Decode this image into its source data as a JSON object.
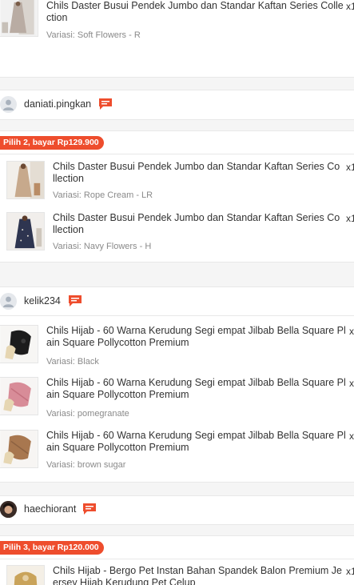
{
  "colors": {
    "accent": "#ee4d2d",
    "muted": "#8a8a8a",
    "divider": "#f5f5f5"
  },
  "qty_label": "x1",
  "top_item": {
    "name_line1": "Chils Daster Busui Pendek Jumbo dan Standar Kaftan Series Colle",
    "name_line2": "ction",
    "variant": "Variasi: Soft Flowers - R",
    "icon": "dress-thumbnail"
  },
  "orders": [
    {
      "buyer": "daniati.pingkan",
      "avatar_icon": "default-user-icon",
      "chat_icon": "chat-icon",
      "promo": "Pilih 2, bayar Rp129.900",
      "items": [
        {
          "name_line1": "Chils Daster Busui Pendek Jumbo dan Standar Kaftan Series Co",
          "name_line2": "llection",
          "variant": "Variasi: Rope Cream - LR"
        },
        {
          "name_line1": "Chils Daster Busui Pendek Jumbo dan Standar Kaftan Series Co",
          "name_line2": "llection",
          "variant": "Variasi: Navy Flowers - H"
        }
      ]
    },
    {
      "buyer": "kelik234",
      "avatar_icon": "default-user-icon",
      "chat_icon": "chat-icon",
      "items": [
        {
          "name_line1": "Chils Hijab - 60 Warna Kerudung Segi empat Jilbab Bella Square Pl",
          "name_line2": "ain Square Pollycotton Premium",
          "variant": "Variasi: Black"
        },
        {
          "name_line1": "Chils Hijab - 60 Warna Kerudung Segi empat Jilbab Bella Square Pl",
          "name_line2": "ain Square Pollycotton Premium",
          "variant": "Variasi: pomegranate"
        },
        {
          "name_line1": "Chils Hijab - 60 Warna Kerudung Segi empat Jilbab Bella Square Pl",
          "name_line2": "ain Square Pollycotton Premium",
          "variant": "Variasi: brown sugar"
        }
      ]
    },
    {
      "buyer": "haechiorant",
      "avatar_icon": "user-photo",
      "chat_icon": "chat-icon",
      "promo": "Pilih 3, bayar Rp120.000",
      "items": [
        {
          "name_line1": "Chils Hijab - Bergo Pet Instan Bahan Spandek Balon Premium Je",
          "name_line2": "ersey Hijab Kerudung Pet Celup"
        }
      ]
    }
  ]
}
